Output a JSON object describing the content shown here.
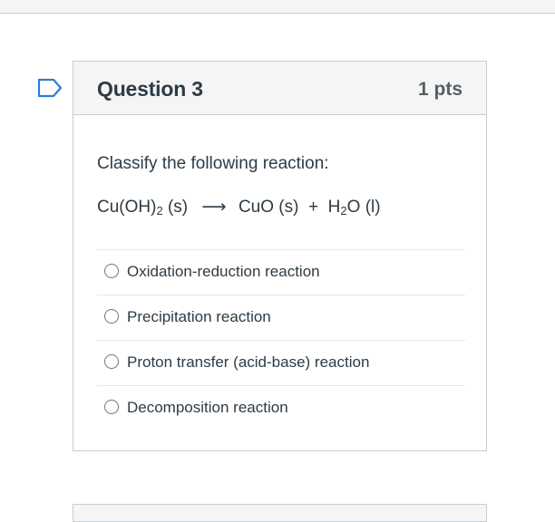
{
  "question": {
    "title": "Question 3",
    "points": "1 pts",
    "prompt": "Classify the following reaction:",
    "equation": {
      "reactant_prefix": "Cu(OH)",
      "reactant_sub": "2",
      "reactant_suffix": " (s)",
      "arrow": "⟶",
      "product1": "CuO (s)",
      "plus": "+",
      "product2_prefix": "H",
      "product2_sub": "2",
      "product2_suffix": "O (l)"
    },
    "answers": [
      {
        "label": "Oxidation-reduction reaction"
      },
      {
        "label": "Precipitation reaction"
      },
      {
        "label": "Proton transfer (acid-base) reaction"
      },
      {
        "label": "Decomposition reaction"
      }
    ]
  },
  "colors": {
    "flag_outline": "#2d7dd2",
    "header_bg": "#f5f5f5",
    "border": "#c7cdd1"
  }
}
